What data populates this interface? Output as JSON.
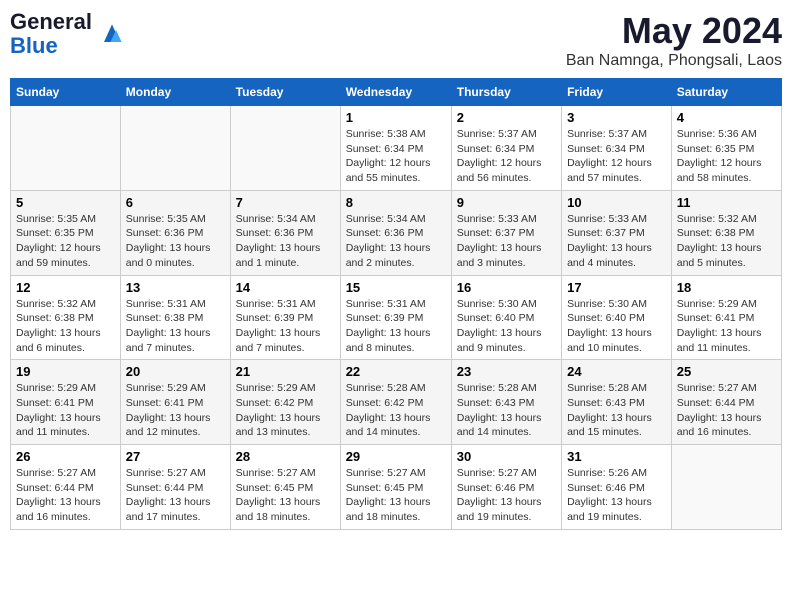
{
  "header": {
    "logo_line1": "General",
    "logo_line2": "Blue",
    "title": "May 2024",
    "subtitle": "Ban Namnga, Phongsali, Laos"
  },
  "weekdays": [
    "Sunday",
    "Monday",
    "Tuesday",
    "Wednesday",
    "Thursday",
    "Friday",
    "Saturday"
  ],
  "weeks": [
    [
      {
        "day": "",
        "info": ""
      },
      {
        "day": "",
        "info": ""
      },
      {
        "day": "",
        "info": ""
      },
      {
        "day": "1",
        "info": "Sunrise: 5:38 AM\nSunset: 6:34 PM\nDaylight: 12 hours\nand 55 minutes."
      },
      {
        "day": "2",
        "info": "Sunrise: 5:37 AM\nSunset: 6:34 PM\nDaylight: 12 hours\nand 56 minutes."
      },
      {
        "day": "3",
        "info": "Sunrise: 5:37 AM\nSunset: 6:34 PM\nDaylight: 12 hours\nand 57 minutes."
      },
      {
        "day": "4",
        "info": "Sunrise: 5:36 AM\nSunset: 6:35 PM\nDaylight: 12 hours\nand 58 minutes."
      }
    ],
    [
      {
        "day": "5",
        "info": "Sunrise: 5:35 AM\nSunset: 6:35 PM\nDaylight: 12 hours\nand 59 minutes."
      },
      {
        "day": "6",
        "info": "Sunrise: 5:35 AM\nSunset: 6:36 PM\nDaylight: 13 hours\nand 0 minutes."
      },
      {
        "day": "7",
        "info": "Sunrise: 5:34 AM\nSunset: 6:36 PM\nDaylight: 13 hours\nand 1 minute."
      },
      {
        "day": "8",
        "info": "Sunrise: 5:34 AM\nSunset: 6:36 PM\nDaylight: 13 hours\nand 2 minutes."
      },
      {
        "day": "9",
        "info": "Sunrise: 5:33 AM\nSunset: 6:37 PM\nDaylight: 13 hours\nand 3 minutes."
      },
      {
        "day": "10",
        "info": "Sunrise: 5:33 AM\nSunset: 6:37 PM\nDaylight: 13 hours\nand 4 minutes."
      },
      {
        "day": "11",
        "info": "Sunrise: 5:32 AM\nSunset: 6:38 PM\nDaylight: 13 hours\nand 5 minutes."
      }
    ],
    [
      {
        "day": "12",
        "info": "Sunrise: 5:32 AM\nSunset: 6:38 PM\nDaylight: 13 hours\nand 6 minutes."
      },
      {
        "day": "13",
        "info": "Sunrise: 5:31 AM\nSunset: 6:38 PM\nDaylight: 13 hours\nand 7 minutes."
      },
      {
        "day": "14",
        "info": "Sunrise: 5:31 AM\nSunset: 6:39 PM\nDaylight: 13 hours\nand 7 minutes."
      },
      {
        "day": "15",
        "info": "Sunrise: 5:31 AM\nSunset: 6:39 PM\nDaylight: 13 hours\nand 8 minutes."
      },
      {
        "day": "16",
        "info": "Sunrise: 5:30 AM\nSunset: 6:40 PM\nDaylight: 13 hours\nand 9 minutes."
      },
      {
        "day": "17",
        "info": "Sunrise: 5:30 AM\nSunset: 6:40 PM\nDaylight: 13 hours\nand 10 minutes."
      },
      {
        "day": "18",
        "info": "Sunrise: 5:29 AM\nSunset: 6:41 PM\nDaylight: 13 hours\nand 11 minutes."
      }
    ],
    [
      {
        "day": "19",
        "info": "Sunrise: 5:29 AM\nSunset: 6:41 PM\nDaylight: 13 hours\nand 11 minutes."
      },
      {
        "day": "20",
        "info": "Sunrise: 5:29 AM\nSunset: 6:41 PM\nDaylight: 13 hours\nand 12 minutes."
      },
      {
        "day": "21",
        "info": "Sunrise: 5:29 AM\nSunset: 6:42 PM\nDaylight: 13 hours\nand 13 minutes."
      },
      {
        "day": "22",
        "info": "Sunrise: 5:28 AM\nSunset: 6:42 PM\nDaylight: 13 hours\nand 14 minutes."
      },
      {
        "day": "23",
        "info": "Sunrise: 5:28 AM\nSunset: 6:43 PM\nDaylight: 13 hours\nand 14 minutes."
      },
      {
        "day": "24",
        "info": "Sunrise: 5:28 AM\nSunset: 6:43 PM\nDaylight: 13 hours\nand 15 minutes."
      },
      {
        "day": "25",
        "info": "Sunrise: 5:27 AM\nSunset: 6:44 PM\nDaylight: 13 hours\nand 16 minutes."
      }
    ],
    [
      {
        "day": "26",
        "info": "Sunrise: 5:27 AM\nSunset: 6:44 PM\nDaylight: 13 hours\nand 16 minutes."
      },
      {
        "day": "27",
        "info": "Sunrise: 5:27 AM\nSunset: 6:44 PM\nDaylight: 13 hours\nand 17 minutes."
      },
      {
        "day": "28",
        "info": "Sunrise: 5:27 AM\nSunset: 6:45 PM\nDaylight: 13 hours\nand 18 minutes."
      },
      {
        "day": "29",
        "info": "Sunrise: 5:27 AM\nSunset: 6:45 PM\nDaylight: 13 hours\nand 18 minutes."
      },
      {
        "day": "30",
        "info": "Sunrise: 5:27 AM\nSunset: 6:46 PM\nDaylight: 13 hours\nand 19 minutes."
      },
      {
        "day": "31",
        "info": "Sunrise: 5:26 AM\nSunset: 6:46 PM\nDaylight: 13 hours\nand 19 minutes."
      },
      {
        "day": "",
        "info": ""
      }
    ]
  ]
}
